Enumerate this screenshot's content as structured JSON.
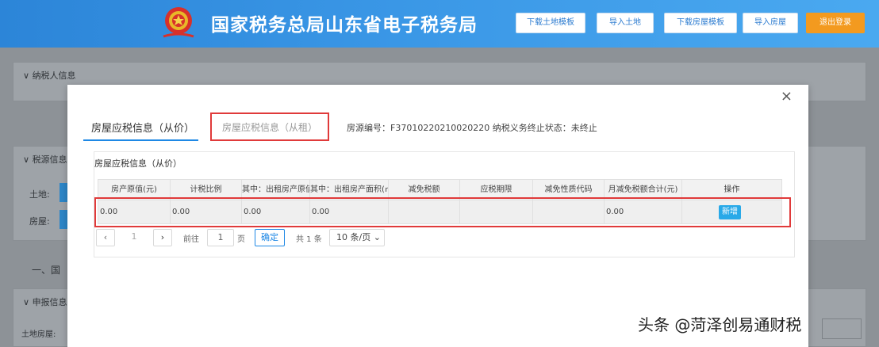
{
  "header": {
    "title": "国家税务总局山东省电子税务局",
    "buttons": [
      "下载土地模板",
      "导入土地",
      "下载房屋模板",
      "导入房屋",
      "退出登录"
    ]
  },
  "background": {
    "panel1_title": "纳税人信息",
    "panel2_title": "税源信息",
    "label_land": "土地:",
    "label_house": "房屋:",
    "section_one": "一、国",
    "panel3_title": "申报信息",
    "row_label": "土地房屋:"
  },
  "modal": {
    "close": "×",
    "tab_active": "房屋应税信息（从价）",
    "tab_inactive": "房屋应税信息（从租）",
    "info": "房源编号：F37010220210020220   纳税义务终止状态：未终止",
    "card_title": "房屋应税信息（从价）",
    "table": {
      "headers": [
        "房产原值(元)",
        "计税比例",
        "其中：出租房产原值(元)",
        "其中：出租房产面积(㎡)",
        "减免税额",
        "应税期限",
        "减免性质代码",
        "月减免税额合计(元)",
        "操作"
      ],
      "row": [
        "0.00",
        "0.00",
        "0.00",
        "0.00",
        "",
        "",
        "",
        "0.00"
      ],
      "action": "新增"
    },
    "pager": {
      "prev": "‹",
      "page": "1",
      "next": "›",
      "goto": "前往",
      "input": "1",
      "unit": "页",
      "ok": "确定",
      "total": "共 1 条",
      "size": "10 条/页"
    }
  },
  "watermark": "头条 @菏泽创易通财税",
  "colors": {
    "header_blue": "#3a97e6",
    "login_orange": "#f39a1f",
    "accent_blue": "#1e88e5",
    "highlight_red": "#e03a3a"
  }
}
